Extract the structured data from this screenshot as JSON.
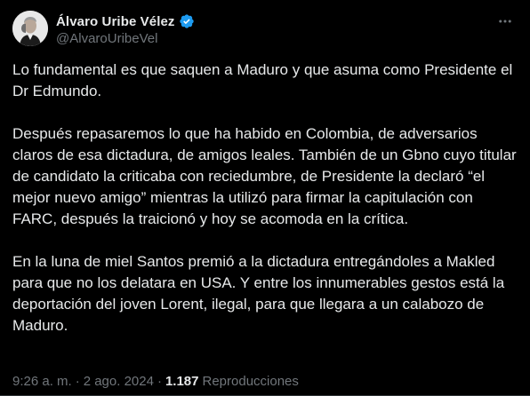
{
  "author": {
    "display_name": "Álvaro Uribe Vélez",
    "handle": "@AlvaroUribeVel",
    "verified": true,
    "avatar_icon": "profile-photo"
  },
  "post": {
    "paragraphs": [
      "Lo fundamental es que saquen a Maduro y que asuma como Presidente el Dr Edmundo.",
      "Después repasaremos lo que ha habido en Colombia, de adversarios claros de esa dictadura, de amigos leales. También de un Gbno cuyo titular de candidato la criticaba con reciedumbre, de Presidente la declaró “el mejor nuevo amigo” mientras la utilizó para firmar la capitulación con FARC, después la traicionó y hoy se acomoda en la crítica.",
      "En la luna de miel Santos premió a la dictadura entregándoles a Makled para que no los delatara en USA. Y entre los innumerables gestos está la deportación del joven Lorent, ilegal, para que llegara a un calabozo de Maduro."
    ]
  },
  "meta": {
    "time": "9:26 a. m.",
    "date": "2 ago. 2024",
    "separator": "·",
    "views_count": "1.187",
    "views_label": "Reproducciones"
  },
  "colors": {
    "background": "#000000",
    "text_primary": "#e7e9ea",
    "text_secondary": "#71767b",
    "verified_blue": "#1d9bf0"
  },
  "icons": {
    "verified": "verified-badge-icon",
    "more": "more-options-icon"
  }
}
